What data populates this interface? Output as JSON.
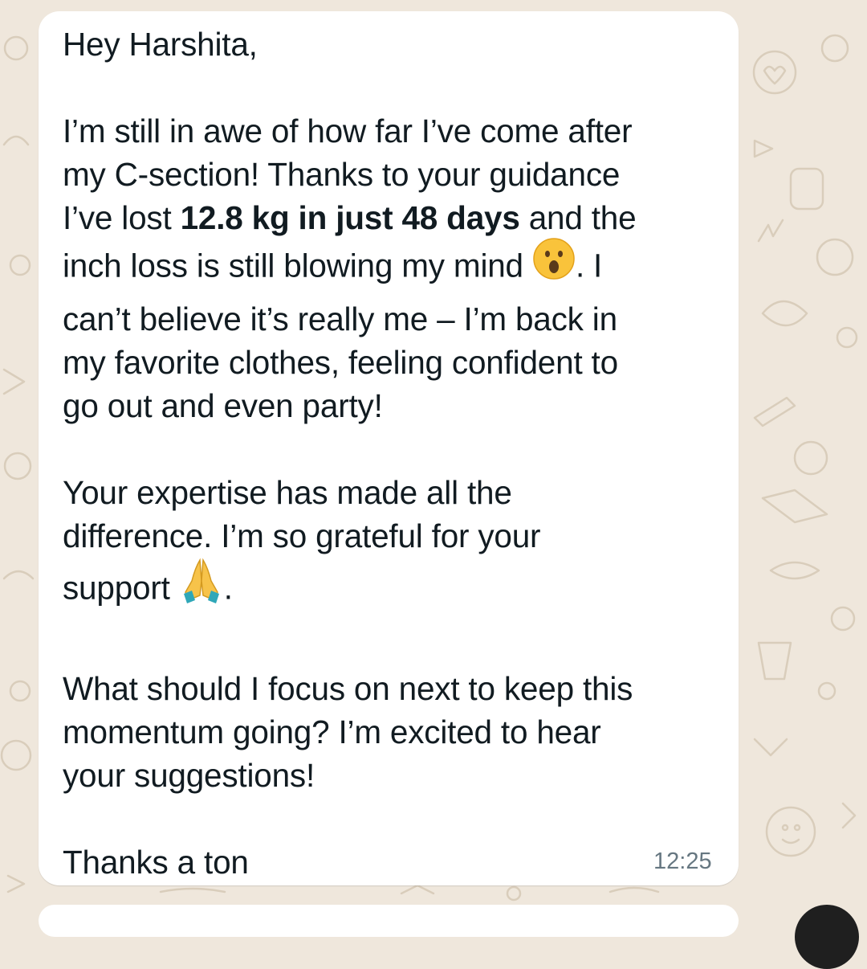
{
  "chat": {
    "message": {
      "greeting": "Hey Harshita,",
      "p1_line1": "I’m still in awe of how far I’ve come after",
      "p1_line2": "my C-section! Thanks to your guidance",
      "p1_line3_pre": "I’ve lost ",
      "p1_line3_bold": "12.8 kg in just 48 days",
      "p1_line3_post": " and the",
      "p1_line4_pre": "inch loss is still blowing my mind ",
      "p1_line4_post": ". I",
      "p1_line5": "can’t believe it’s really me – I’m back in",
      "p1_line6": "my favorite clothes, feeling confident to",
      "p1_line7": "go out and even party!",
      "p2_line1": "Your expertise has made all the",
      "p2_line2": "difference. I’m so grateful for your",
      "p2_line3_pre": "support ",
      "p2_line3_post": ".",
      "p3_line1": "What should I focus on next to keep this",
      "p3_line2": "momentum going? I’m excited to hear",
      "p3_line3": "your suggestions!",
      "signoff": "Thanks a ton",
      "time": "12:25"
    },
    "icons": {
      "emoji_1": "astonished-face-icon",
      "emoji_2": "folded-hands-icon"
    }
  }
}
